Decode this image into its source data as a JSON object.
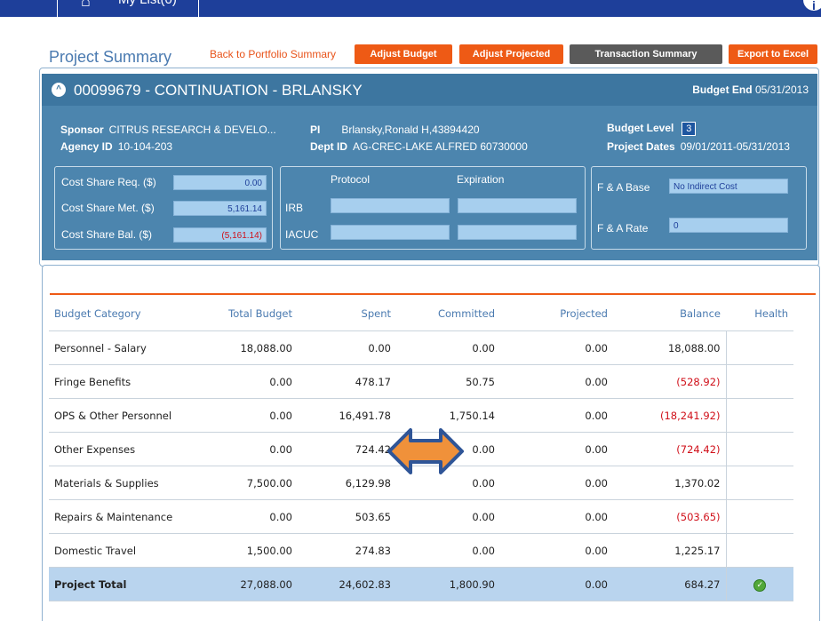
{
  "topnav": {
    "home_icon": "home-icon",
    "my_list_label": "My List(0)",
    "right_icon": "help-circle-icon",
    "right_glyph": "i"
  },
  "page": {
    "title": "Project Summary",
    "back_link": "Back to Portfolio Summary",
    "buttons": {
      "adjust_budget": "Adjust Budget",
      "adjust_projected": "Adjust Projected",
      "transaction_summary": "Transaction Summary",
      "export_excel": "Export to Excel"
    }
  },
  "project": {
    "title": "00099679 - CONTINUATION - BRLANSKY",
    "collapse_glyph": "^",
    "budget_end_label": "Budget End",
    "budget_end_value": "05/31/2013",
    "sponsor_label": "Sponsor",
    "sponsor_value": "CITRUS RESEARCH & DEVELO...",
    "agency_label": "Agency ID",
    "agency_value": "10-104-203",
    "pi_label": "PI",
    "pi_value": "Brlansky,Ronald H,43894420",
    "dept_label": "Dept ID",
    "dept_value": "AG-CREC-LAKE ALFRED 60730000",
    "budget_level_label": "Budget Level",
    "budget_level_value": "3",
    "project_dates_label": "Project Dates",
    "project_dates_value": "09/01/2011-05/31/2013"
  },
  "cost_share": {
    "req_label": "Cost Share Req. ($)",
    "req_value": "0.00",
    "met_label": "Cost Share Met. ($)",
    "met_value": "5,161.14",
    "bal_label": "Cost Share Bal. ($)",
    "bal_value": "(5,161.14)"
  },
  "protocol": {
    "protocol_header": "Protocol",
    "expiration_header": "Expiration",
    "irb_label": "IRB",
    "iacuc_label": "IACUC"
  },
  "fa": {
    "base_label": "F & A Base",
    "base_value": "No Indirect Cost",
    "rate_label": "F & A Rate",
    "rate_value": "0"
  },
  "budget_table": {
    "headers": {
      "category": "Budget Category",
      "total": "Total Budget",
      "spent": "Spent",
      "committed": "Committed",
      "projected": "Projected",
      "balance": "Balance",
      "health": "Health"
    },
    "rows": [
      {
        "category": "Personnel - Salary",
        "total": "18,088.00",
        "spent": "0.00",
        "committed": "0.00",
        "projected": "0.00",
        "balance": "18,088.00"
      },
      {
        "category": "Fringe Benefits",
        "total": "0.00",
        "spent": "478.17",
        "committed": "50.75",
        "projected": "0.00",
        "balance": "(528.92)"
      },
      {
        "category": "OPS & Other Personnel",
        "total": "0.00",
        "spent": "16,491.78",
        "committed": "1,750.14",
        "projected": "0.00",
        "balance": "(18,241.92)"
      },
      {
        "category": "Other Expenses",
        "total": "0.00",
        "spent": "724.42",
        "committed": "0.00",
        "projected": "0.00",
        "balance": "(724.42)"
      },
      {
        "category": "Materials & Supplies",
        "total": "7,500.00",
        "spent": "6,129.98",
        "committed": "0.00",
        "projected": "0.00",
        "balance": "1,370.02"
      },
      {
        "category": "Repairs & Maintenance",
        "total": "0.00",
        "spent": "503.65",
        "committed": "0.00",
        "projected": "0.00",
        "balance": "(503.65)"
      },
      {
        "category": "Domestic Travel",
        "total": "1,500.00",
        "spent": "274.83",
        "committed": "0.00",
        "projected": "0.00",
        "balance": "1,225.17"
      }
    ],
    "total_row": {
      "category": "Project Total",
      "total": "27,088.00",
      "spent": "24,602.83",
      "committed": "1,800.90",
      "projected": "0.00",
      "balance": "684.27",
      "health_icon": "check-circle-icon",
      "health_glyph": "✓"
    }
  },
  "overlay": {
    "icon": "double-arrow-icon"
  },
  "colors": {
    "accent_orange": "#ee5a15",
    "panel_blue": "#4c85ae",
    "negative_red": "#d0101a",
    "total_row_bg": "#b9d4ee"
  }
}
